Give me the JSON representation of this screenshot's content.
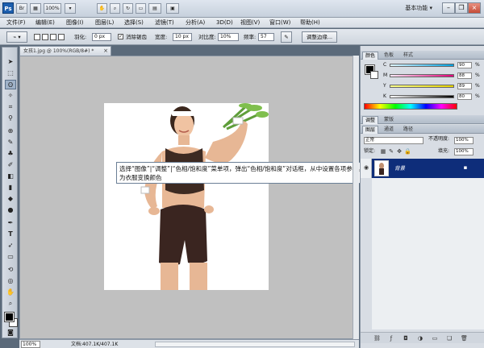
{
  "app": {
    "logo": "Ps",
    "zoom": "100%",
    "workspace": "基本功能 ▾"
  },
  "menu": [
    "文件(F)",
    "编辑(E)",
    "图像(I)",
    "图层(L)",
    "选择(S)",
    "滤镜(T)",
    "分析(A)",
    "3D(D)",
    "视图(V)",
    "窗口(W)",
    "帮助(H)"
  ],
  "options": {
    "feather_label": "羽化:",
    "feather_value": "0 px",
    "antialias_label": "消除锯齿",
    "width_label": "宽度:",
    "width_value": "10 px",
    "contrast_label": "对比度:",
    "contrast_value": "10%",
    "frequency_label": "频率:",
    "frequency_value": "57",
    "refine_button": "调整边缘..."
  },
  "document": {
    "tab_title": "女孩1.jpg @ 100%(RGB/8#) *",
    "zoom": "100%",
    "doc_info": "文档:407.1K/407.1K"
  },
  "callout_text": "选择“图像”|“调整”|“色相/饱和度”菜单项，弹出“色相/饱和度”对话框，从中设置各项参数，为衣服变换颜色",
  "panels": {
    "color_tabs": [
      "颜色",
      "色板",
      "样式"
    ],
    "cmyk": [
      {
        "label": "C",
        "value": "90",
        "color": "#e0f6ff"
      },
      {
        "label": "M",
        "value": "88",
        "color": "#ffe8f7"
      },
      {
        "label": "Y",
        "value": "89",
        "color": "#fbff8e"
      },
      {
        "label": "K",
        "value": "80",
        "color": "#d9d9d9"
      }
    ],
    "pct": "%",
    "adjust_tabs": [
      "调整",
      "蒙版"
    ],
    "layer_tabs": [
      "图层",
      "通道",
      "路径"
    ],
    "blend_mode": "正常",
    "opacity_label": "不透明度:",
    "opacity_value": "100%",
    "lock_label": "锁定:",
    "fill_label": "填充:",
    "fill_value": "100%",
    "layer_name": "背景"
  }
}
